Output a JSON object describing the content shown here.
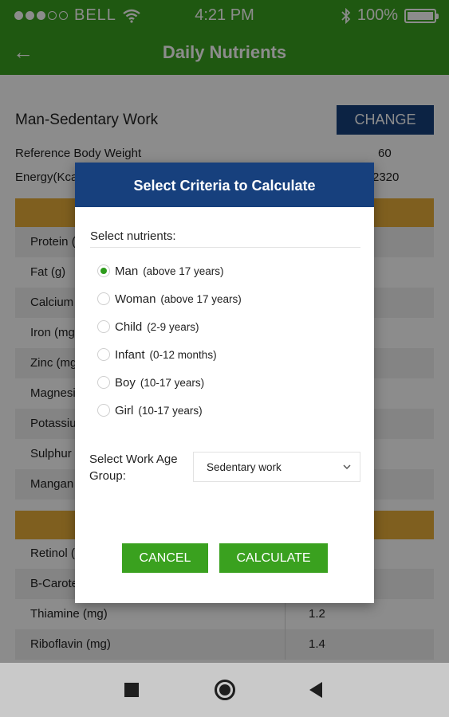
{
  "status_bar": {
    "carrier": "BELL",
    "time": "4:21 PM",
    "battery": "100%",
    "battery_level": 1.0
  },
  "app_bar": {
    "back_glyph": "←",
    "title": "Daily Nutrients"
  },
  "profile": {
    "title": "Man-Sedentary Work",
    "change_label": "CHANGE",
    "reference_weight_label": "Reference Body Weight",
    "reference_weight_value": "60",
    "energy_label": "Energy(Kca",
    "energy_value": "2320"
  },
  "nutrients_partial": [
    {
      "name": "Protein ("
    },
    {
      "name": "Fat (g)"
    },
    {
      "name": "Calcium"
    },
    {
      "name": "Iron (mg"
    },
    {
      "name": "Zinc (mg"
    },
    {
      "name": "Magnesi"
    },
    {
      "name": "Potassiu"
    },
    {
      "name": "Sulphur"
    },
    {
      "name": "Mangan"
    }
  ],
  "vitamins_partial": [
    {
      "name": "Retinol (",
      "value": ""
    },
    {
      "name": "B-Carote",
      "value": ""
    },
    {
      "name": "Thiamine (mg)",
      "value": "1.2"
    },
    {
      "name": "Riboflavin (mg)",
      "value": "1.4"
    }
  ],
  "dialog": {
    "title": "Select Criteria to Calculate",
    "subtitle": "Select nutrients:",
    "options": [
      {
        "label": "Man",
        "detail": "(above 17 years)",
        "selected": true
      },
      {
        "label": "Woman",
        "detail": "(above 17 years)",
        "selected": false
      },
      {
        "label": "Child",
        "detail": "(2-9 years)",
        "selected": false
      },
      {
        "label": "Infant",
        "detail": "(0-12 months)",
        "selected": false
      },
      {
        "label": "Boy",
        "detail": "(10-17 years)",
        "selected": false
      },
      {
        "label": "Girl",
        "detail": "(10-17 years)",
        "selected": false
      }
    ],
    "work_group_label": "Select Work Age Group:",
    "work_group_value": "Sedentary work",
    "cancel_label": "CANCEL",
    "calculate_label": "CALCULATE"
  },
  "colors": {
    "primary_green": "#3aa11f",
    "header_navy": "#17407d",
    "section_orange": "#e8ad3a"
  }
}
